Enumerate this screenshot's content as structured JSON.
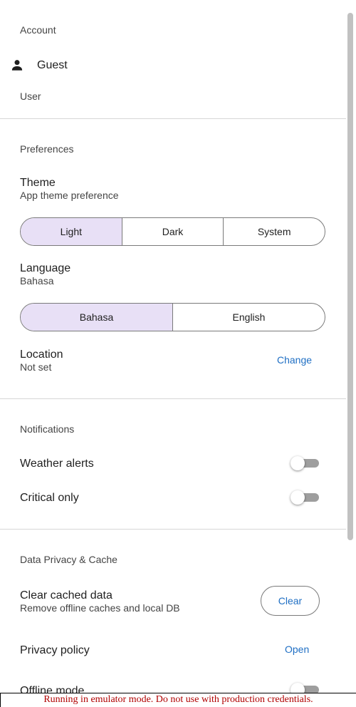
{
  "account": {
    "section_title": "Account",
    "user_name": "Guest",
    "user_role": "User",
    "icon": "person-icon"
  },
  "preferences": {
    "section_title": "Preferences",
    "theme": {
      "title": "Theme",
      "subtitle": "App theme preference",
      "options": [
        "Light",
        "Dark",
        "System"
      ],
      "selected": "Light"
    },
    "language": {
      "title": "Language",
      "subtitle": "Bahasa",
      "options": [
        "Bahasa",
        "English"
      ],
      "selected": "Bahasa"
    },
    "location": {
      "title": "Location",
      "subtitle": "Not set",
      "action_label": "Change"
    }
  },
  "notifications": {
    "section_title": "Notifications",
    "weather_alerts": {
      "label": "Weather alerts",
      "enabled": false
    },
    "critical_only": {
      "label": "Critical only",
      "enabled": false
    }
  },
  "data_privacy": {
    "section_title": "Data Privacy & Cache",
    "clear_cache": {
      "title": "Clear cached data",
      "subtitle": "Remove offline caches and local DB",
      "button_label": "Clear"
    },
    "privacy_policy": {
      "title": "Privacy policy",
      "action_label": "Open"
    },
    "offline_mode": {
      "label": "Offline mode",
      "enabled": false
    }
  },
  "banner": {
    "text": "Running in emulator mode. Do not use with production credentials."
  },
  "colors": {
    "accent_link": "#1f6fc4",
    "segment_selected": "#e8e0f6",
    "banner_text": "#b00000"
  }
}
